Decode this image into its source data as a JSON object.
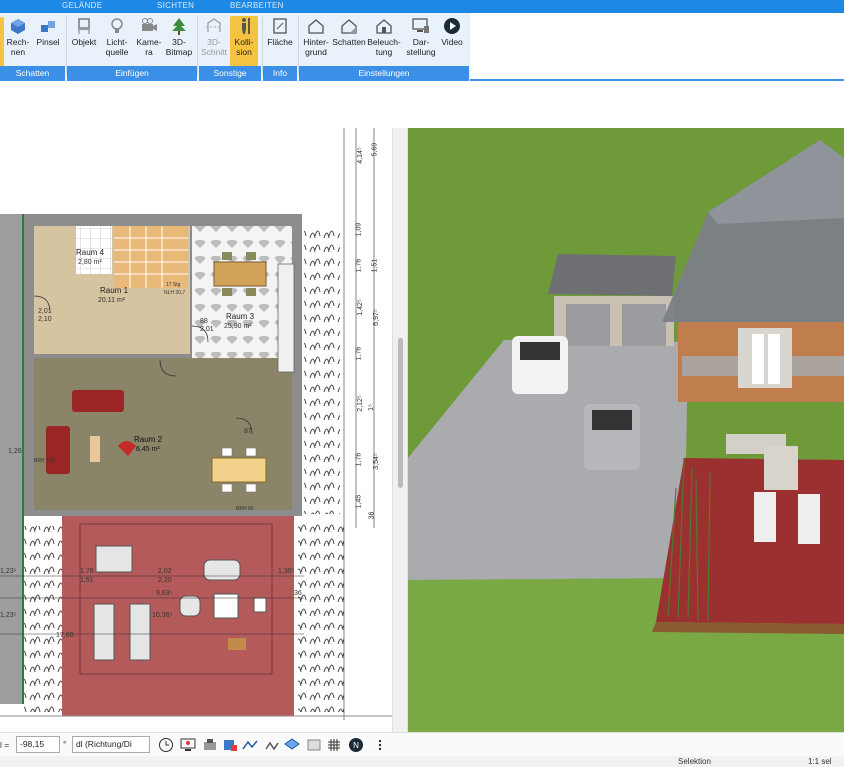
{
  "ribbon": {
    "tabs": [
      "GELÄNDE",
      "SICHTEN",
      "BEARBEITEN"
    ],
    "buttons": {
      "rechnen": "Rech-\nnen",
      "pinsel": "Pinsel",
      "objekt": "Objekt",
      "lichtquelle": "Licht-\nquelle",
      "kamera": "Kame-\nra",
      "bitmap": "3D-\nBitmap",
      "schnitt": "3D-\nSchnitt",
      "kollision": "Kolli-\nsion",
      "flaeche": "Fläche",
      "hintergrund": "Hinter-\ngrund",
      "schatten": "Schatten",
      "beleuchtung": "Beleuch-\ntung",
      "darstellung": "Dar-\nstellung",
      "video": "Video"
    },
    "groups": {
      "schatten": "Schatten",
      "einfuegen": "Einfügen",
      "sonstige": "Sonstige",
      "info": "Info",
      "einstellungen": "Einstellungen"
    }
  },
  "plan": {
    "rooms": [
      {
        "name": "Raum 4",
        "area": "2,80 m²"
      },
      {
        "name": "Raum 1",
        "area": "20,11 m²"
      },
      {
        "name": "Raum 3",
        "area": "25,90 m²"
      },
      {
        "name": "Raum 2",
        "area": "6,45 m²"
      }
    ],
    "right_dims": [
      "5,69",
      "4,14⁵",
      "1,09",
      "1,51",
      "1,76",
      "6,97⁵",
      "1,42⁵",
      "1,76",
      "1⁵",
      "2,12⁵",
      "3,54⁵",
      "1,76",
      "1,45",
      "36"
    ],
    "terrace_dims": [
      "1,76",
      "1,51",
      "2,02",
      "2,20",
      "1,23⁵",
      "1,30⁵",
      "1,23⁵",
      "9,63⁵",
      "10,36⁵",
      "17,60",
      "36"
    ],
    "small_labels": [
      "2,01",
      "2,10",
      "1,26",
      "BRH 1,01",
      "88",
      "2,01",
      "NLH 2,13",
      "17 Stg",
      "NLH 30,7",
      "87",
      "2,01",
      "BRH 85"
    ]
  },
  "toolbar": {
    "coord_prefix": "l =",
    "coord_value": "-98,15",
    "angle_unit": "°",
    "direction_select": "dl (Richtung/Di"
  },
  "status": {
    "mode": "Selektion",
    "scale": "1:1 sel"
  },
  "colors": {
    "ribbon_blue": "#1e88e5",
    "group_blue": "#3b8fe6",
    "active_yellow": "#f5c242",
    "terrace_red": "#b55a5a",
    "lawn_green": "#6f9a3a"
  }
}
